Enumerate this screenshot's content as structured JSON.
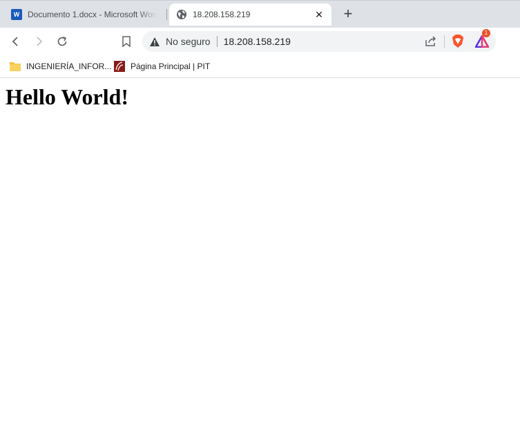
{
  "tabs": [
    {
      "title": "Documento 1.docx - Microsoft Word",
      "icon": "word-icon",
      "active": false
    },
    {
      "title": "18.208.158.219",
      "icon": "globe-icon",
      "active": true
    }
  ],
  "word_badge": "W",
  "close_tab": "✕",
  "new_tab": "+",
  "omnibox": {
    "security_text": "No seguro",
    "url": "18.208.158.219"
  },
  "extension_badge": "1",
  "bookmarks": [
    {
      "label": "INGENIERÍA_INFOR...",
      "icon": "folder-icon"
    },
    {
      "label": "Página Principal | PIT",
      "icon": "pit-logo-icon"
    }
  ],
  "page": {
    "heading": "Hello World!"
  },
  "colors": {
    "frame": "#dee1e6",
    "brave_orange": "#fb542b",
    "rewards_purple": "#5a2ee5",
    "folder_yellow": "#f6c244",
    "pit_red": "#8b1a1a"
  }
}
